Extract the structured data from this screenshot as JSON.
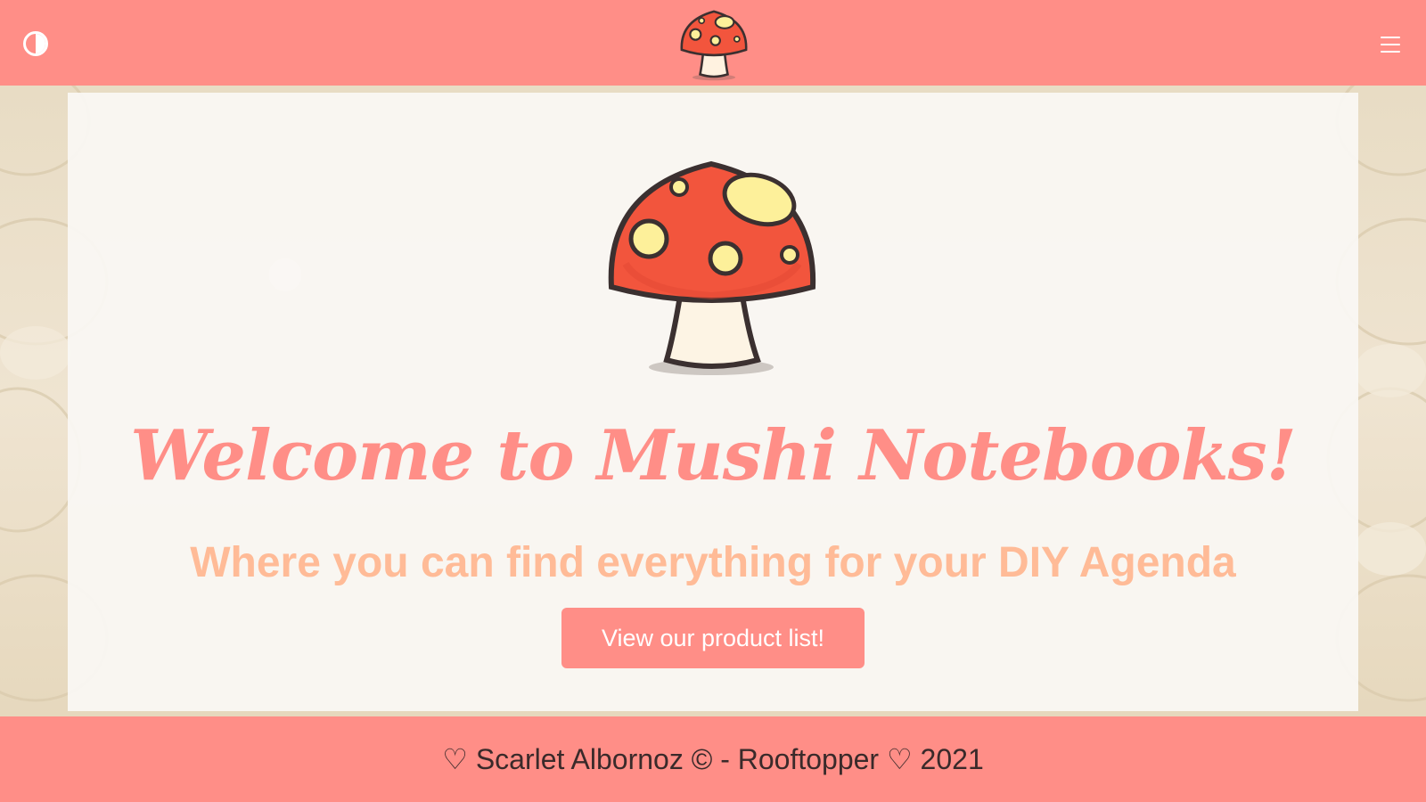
{
  "header": {
    "theme_toggle_icon": "contrast-icon",
    "menu_icon": "hamburger-menu-icon",
    "logo_icon": "mushroom-logo-icon"
  },
  "hero": {
    "image_icon": "mushroom-icon",
    "title": "Welcome to Mushi Notebooks!",
    "subtitle": "Where you can find everything for your DIY Agenda",
    "cta_label": "View our product list!"
  },
  "footer": {
    "text": "♡ Scarlet Albornoz © - Rooftopper ♡ 2021"
  },
  "colors": {
    "primary": "#ff8e87",
    "subtitle": "#ffbb97",
    "panel_bg": "#faf7f4",
    "footer_text": "#3a2a2a"
  }
}
